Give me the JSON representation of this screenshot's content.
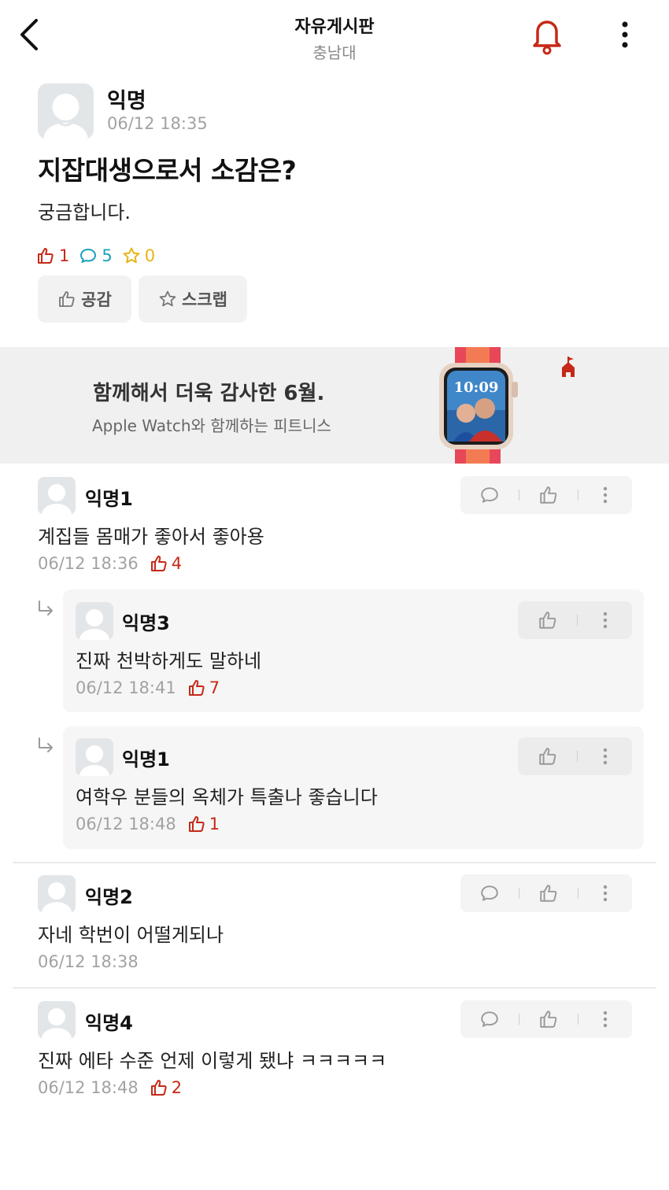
{
  "header": {
    "title": "자유게시판",
    "subtitle": "충남대"
  },
  "post": {
    "author": "익명",
    "time": "06/12 18:35",
    "title": "지잡대생으로서 소감은?",
    "body": "궁금합니다.",
    "likes": "1",
    "comments": "5",
    "scraps": "0",
    "empathy_label": "공감",
    "scrap_label": "스크랩"
  },
  "banner": {
    "title": "함께해서 더욱 감사한 6월.",
    "subtitle": "Apple Watch와 함께하는 피트니스",
    "watch_time": "10:09"
  },
  "comments": [
    {
      "author": "익명1",
      "text": "계집들 몸매가 좋아서 좋아용",
      "time": "06/12 18:36",
      "likes": "4"
    },
    {
      "author": "익명3",
      "text": "진짜 천박하게도 말하네",
      "time": "06/12 18:41",
      "likes": "7"
    },
    {
      "author": "익명1",
      "text": "여학우 분들의 옥체가 특출나 좋습니다",
      "time": "06/12 18:48",
      "likes": "1"
    },
    {
      "author": "익명2",
      "text": "자네 학번이 어떨게되나",
      "time": "06/12 18:38",
      "likes": ""
    },
    {
      "author": "익명4",
      "text": "진짜 에타 수준 언제 이렇게 됐냐 ㅋㅋㅋㅋㅋ",
      "time": "06/12 18:48",
      "likes": "2"
    }
  ],
  "colors": {
    "accent": "#c62917",
    "comment": "#1aa3bd",
    "scrap": "#e8b416"
  }
}
